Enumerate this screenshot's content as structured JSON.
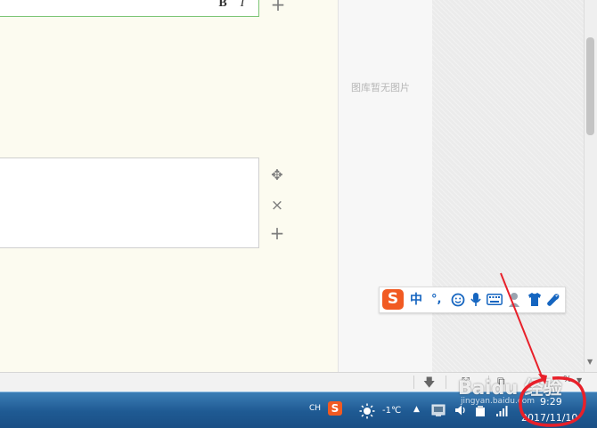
{
  "editor": {
    "format_buttons": {
      "bold": "B",
      "italic": "I"
    },
    "tools_top": {
      "add": "+"
    },
    "tools_block": {
      "move": "✥",
      "delete": "×",
      "add": "+"
    }
  },
  "gallery": {
    "empty_text": "图库暂无图片"
  },
  "status_bar": {
    "zoom_partial": "%"
  },
  "ime": {
    "logo": "S",
    "mode": "中",
    "punct": "°,",
    "icons": [
      "smile-icon",
      "mic-icon",
      "keyboard-icon",
      "user-icon",
      "shirt-icon",
      "wrench-icon"
    ]
  },
  "taskbar": {
    "lang": "CH",
    "weather_temp": "-1℃",
    "time": "9:29",
    "date": "2017/11/10"
  },
  "watermark": {
    "text": "Baidu 经验",
    "sub": "jingyan.baidu.com"
  },
  "colors": {
    "taskbar": "#1f5a93",
    "annotation": "#e8202a",
    "ime_logo": "#f15a22",
    "ime_accent": "#1565c0"
  }
}
